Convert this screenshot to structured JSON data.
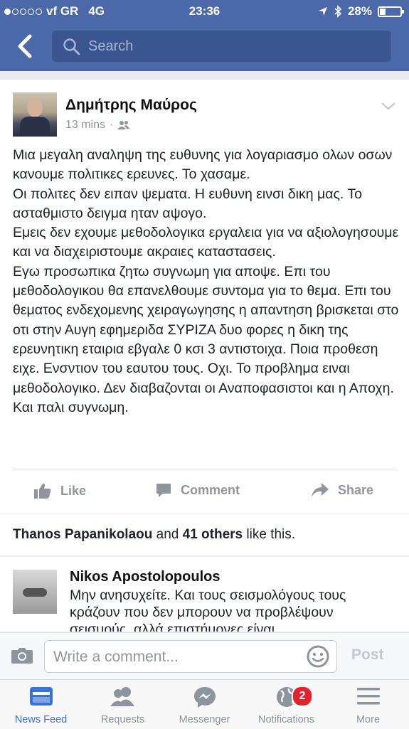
{
  "status_bar": {
    "carrier": "vf GR",
    "network": "4G",
    "time": "23:36",
    "battery": "28%",
    "battery_level": 0.28
  },
  "search": {
    "placeholder": "Search"
  },
  "post": {
    "author": "Δημήτρης Μαύρος",
    "time": "13 mins",
    "separator": "·",
    "text": "Μια μεγαλη αναληψη της ευθυνης για λογαριασμο ολων οσων κανουμε πολιτικες ερευνες. Το χασαμε.\nΟι πολιτες δεν ειπαν ψεματα. Η ευθυνη εινσι δικη μας. Το ασταθμιστο δειγμα ηταν αψογο.\nΕμεις δεν εχουμε μεθοδολογικα εργαλεια για να αξιολογησουμε και να διαχειριστουμε ακραιες καταστασεις.\nΕγω προσωπικα ζητω συγνωμη για αποψε. Επι του μεθοδολογικου θα επανελθουμε συντομα για το θεμα. Επι του θεματος ενδεχομενης χειραγωγησης η απαντηση βρισκεται στο οτι στην Αυγη εφημεριδα ΣΥΡΙΖΑ δυο φορες η δικη της ερευνητικη εταιρια εβγαλε 0 κσι 3 αντιστοιχα. Ποια προθεση ειχε. Ενσντιον του εαυτου τους. Οχι. Το προβλημα ειναι μεθοδολογικο. Δεν διαβαζονται οι Αναποφασιστοι και η Αποχη. Και παλι συγνωμη.",
    "actions": {
      "like": "Like",
      "comment": "Comment",
      "share": "Share"
    }
  },
  "likes": {
    "name": "Thanos Papanikolaou",
    "and": "and",
    "others": "41 others",
    "suffix": "like this."
  },
  "comment": {
    "author": "Nikos Apostolopoulos",
    "text": "Μην ανησυχείτε. Και τους σεισμολόγους τους κράζουν που δεν μπορουν να προβλέψουν σεισμούς, αλλά επιστήμονες είναι"
  },
  "composer": {
    "placeholder": "Write a comment...",
    "post_label": "Post"
  },
  "tabs": [
    {
      "label": "News Feed",
      "icon": "news-feed-icon",
      "active": true
    },
    {
      "label": "Requests",
      "icon": "requests-icon"
    },
    {
      "label": "Messenger",
      "icon": "messenger-icon"
    },
    {
      "label": "Notifications",
      "icon": "globe-icon",
      "badge": "2"
    },
    {
      "label": "More",
      "icon": "menu-icon"
    }
  ],
  "colors": {
    "brand": "#4b69a8",
    "active_tab": "#3b72d6",
    "badge": "#e0242c"
  }
}
